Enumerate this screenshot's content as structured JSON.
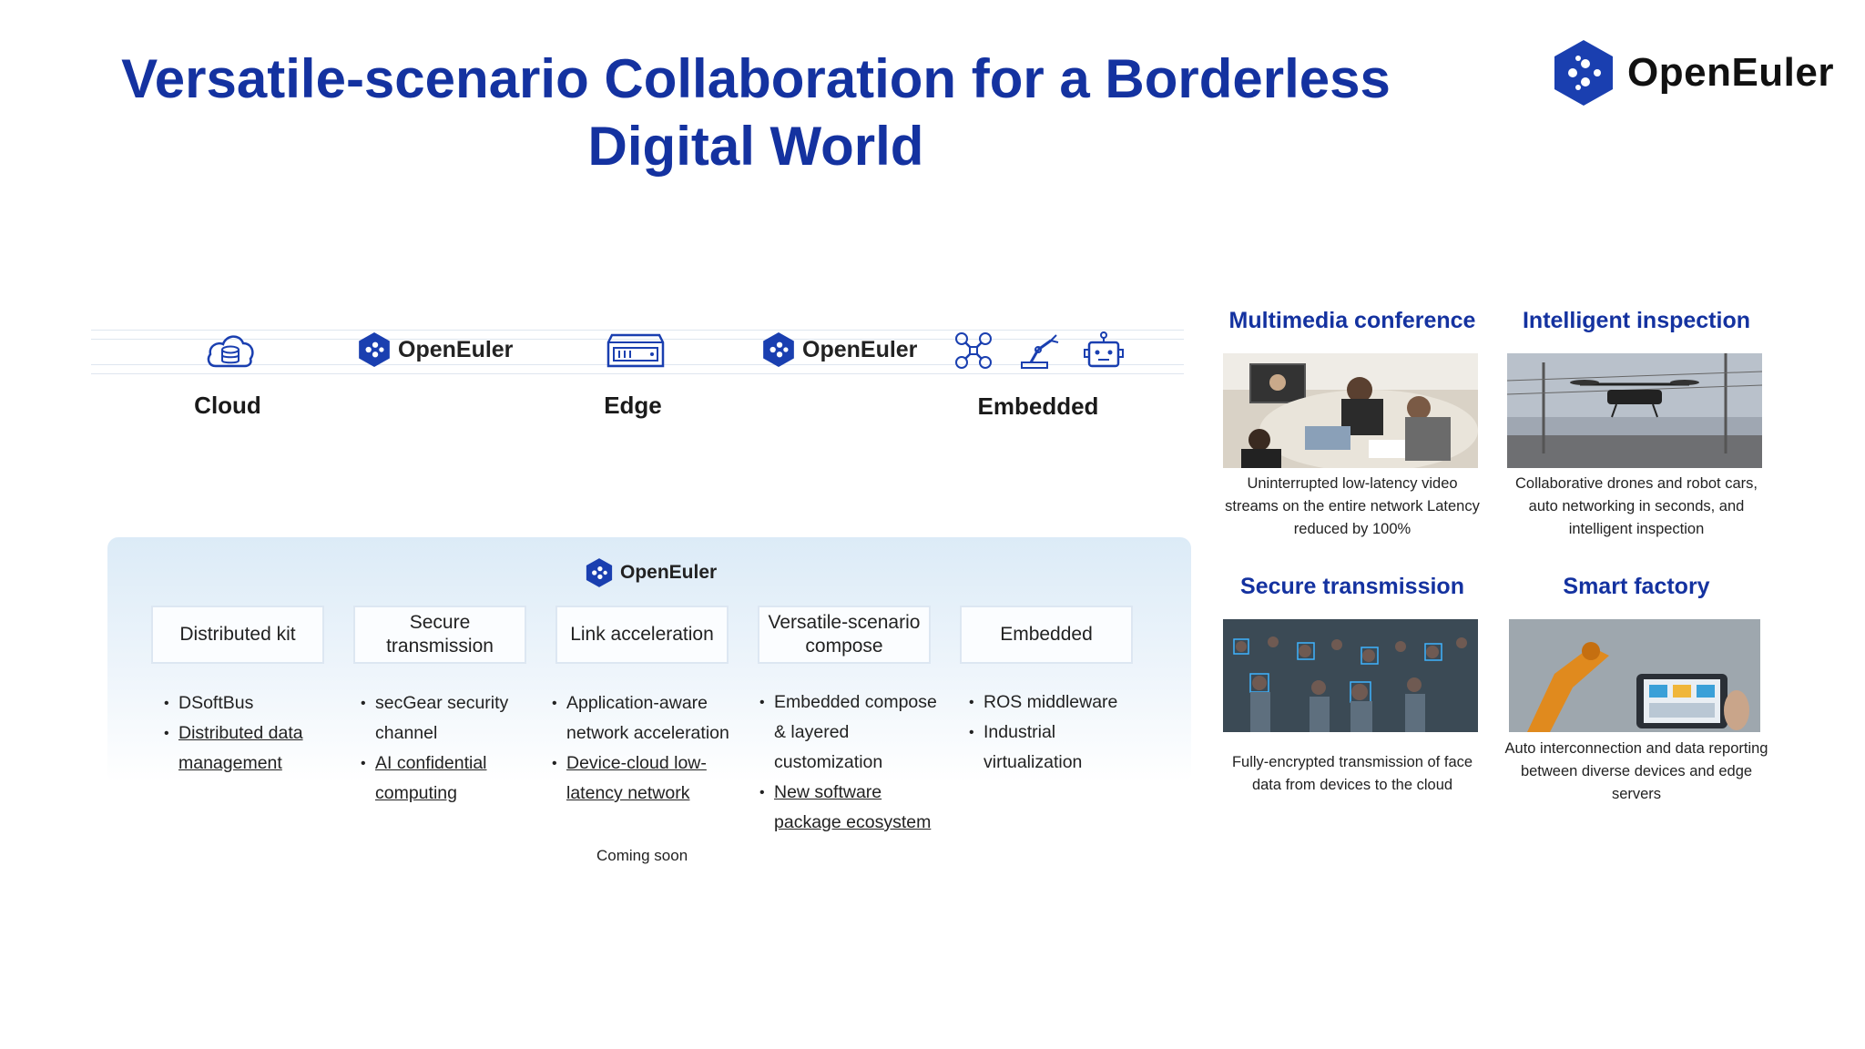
{
  "title": "Versatile-scenario Collaboration for a Borderless Digital World",
  "brand": {
    "name": "OpenEuler"
  },
  "strip": {
    "cloud_label": "Cloud",
    "edge_label": "Edge",
    "embedded_label": "Embedded",
    "logo1": "OpenEuler",
    "logo2": "OpenEuler"
  },
  "panel": {
    "logo": "OpenEuler",
    "modules": [
      {
        "label": "Distributed kit"
      },
      {
        "label": "Secure transmission"
      },
      {
        "label": "Link acceleration"
      },
      {
        "label": "Versatile-scenario compose"
      },
      {
        "label": "Embedded"
      }
    ],
    "bullets": {
      "col1": [
        "DSoftBus",
        "Distributed data management"
      ],
      "col2": [
        "secGear security channel",
        "AI confidential computing"
      ],
      "col3": [
        "Application-aware network acceleration",
        "Device-cloud low-latency network"
      ],
      "col4": [
        "Embedded compose & layered customization",
        "New software package ecosystem"
      ],
      "col5": [
        "ROS middleware",
        "Industrial virtualization"
      ]
    },
    "coming_soon": "Coming soon"
  },
  "scenarios": [
    {
      "title": "Multimedia conference",
      "desc": "Uninterrupted low-latency video streams on the entire network Latency reduced by 100%"
    },
    {
      "title": "Intelligent inspection",
      "desc": "Collaborative drones and robot cars, auto networking in seconds, and intelligent inspection"
    },
    {
      "title": "Secure transmission",
      "desc": "Fully-encrypted transmission of face data from devices to the cloud"
    },
    {
      "title": "Smart factory",
      "desc": "Auto interconnection and data reporting between diverse devices and edge servers"
    }
  ],
  "colors": {
    "title_blue": "#1432a0",
    "logo_blue": "#1a3fb0"
  },
  "icons": [
    "cloud-database-icon",
    "edge-server-icon",
    "drone-icon",
    "robot-arm-icon",
    "robot-face-icon",
    "openeuler-logo-icon"
  ]
}
